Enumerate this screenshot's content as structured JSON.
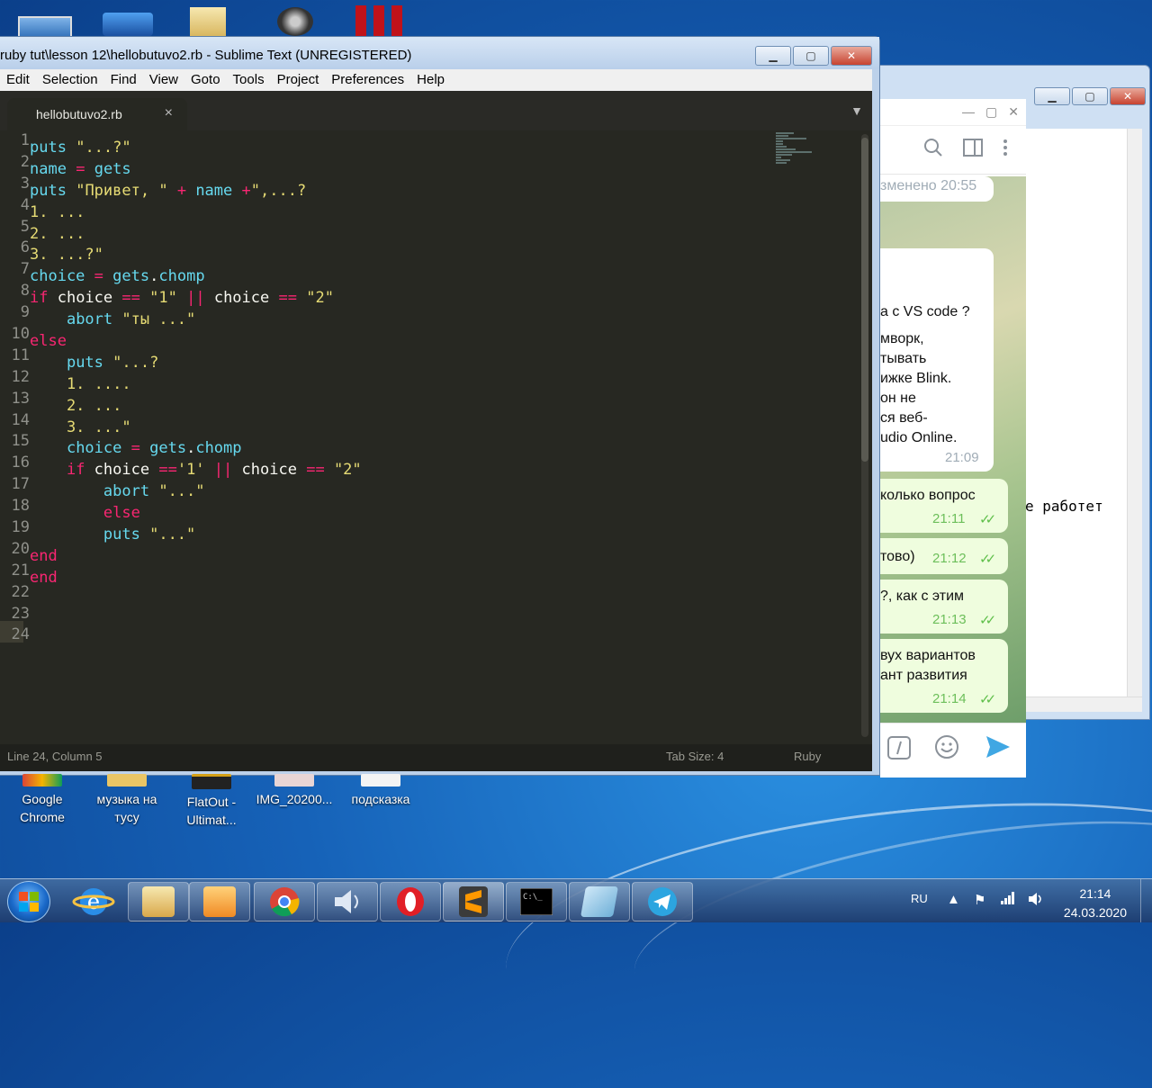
{
  "sublime": {
    "title": "ruby tut\\lesson 12\\hellobutuvo2.rb - Sublime Text (UNREGISTERED)",
    "menu": [
      "Edit",
      "Selection",
      "Find",
      "View",
      "Goto",
      "Tools",
      "Project",
      "Preferences",
      "Help"
    ],
    "tab_name": "hellobutuvo2.rb",
    "tab_close": "×",
    "code_lines": [
      "puts \"...?\"",
      "name = gets",
      "puts \"Привет, \" + name +\",...?",
      "1. ...",
      "2. ...",
      "3. ...?\"",
      "choice = gets.chomp",
      "if choice == \"1\" || choice == \"2\"",
      "    abort \"ты ...\"",
      "else",
      "    puts \"...?",
      "    1. ....",
      "    2. ...",
      "    3. ...\"",
      "    choice = gets.chomp",
      "    if choice =='1' || choice == \"2\"",
      "        abort \"...\"",
      "        else",
      "        puts \"...\"",
      "end",
      "end",
      "",
      "",
      ""
    ],
    "status": {
      "position": "Line 24, Column 5",
      "tab_size": "Tab Size: 4",
      "syntax": "Ruby"
    }
  },
  "telegram": {
    "bubbles": [
      {
        "lines": [
          "зменено 20:55"
        ],
        "time": ""
      },
      {
        "lines": [
          "а с VS code ?",
          "мворк,",
          "тывать",
          "ижке Blink.",
          "он не",
          "ся веб-",
          "udio Online."
        ],
        "time": "21:09"
      },
      {
        "lines": [
          "колько вопрос"
        ],
        "time": "21:11"
      },
      {
        "lines": [
          "тово)"
        ],
        "time": "21:12"
      },
      {
        "lines": [
          "?, как с этим"
        ],
        "time": "21:13"
      },
      {
        "lines": [
          "вух вариантов",
          "ант развития"
        ],
        "time": "21:14"
      }
    ],
    "check_mark": "✓✓"
  },
  "back_window": {
    "text": "е работет"
  },
  "desktop_icons": [
    {
      "label": "Google Chrome"
    },
    {
      "label": "музыка на тусу"
    },
    {
      "label": "FlatOut - Ultimat..."
    },
    {
      "label": "IMG_20200..."
    },
    {
      "label": "подсказка"
    }
  ],
  "taskbar": {
    "apps": [
      "explorer",
      "internet-explorer",
      "folder",
      "media-player",
      "chrome",
      "volume-app",
      "opera",
      "sublime-text",
      "cmd",
      "notepad",
      "telegram"
    ],
    "lang": "RU",
    "time": "21:14",
    "date": "24.03.2020"
  },
  "colors": {
    "editor_bg": "#272822",
    "keyword": "#f92672",
    "function": "#66d9ef",
    "string": "#e6db74"
  }
}
